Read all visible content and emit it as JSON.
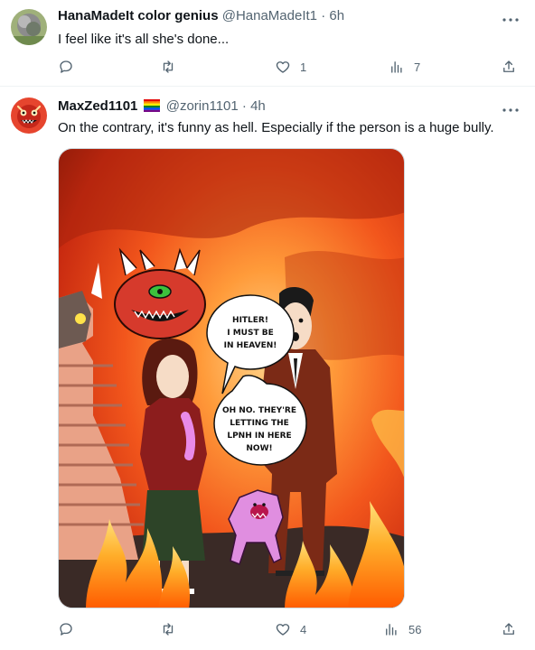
{
  "tweets": [
    {
      "display_name": "HanaMadeIt color genius",
      "handle": "@HanaMadeIt1",
      "time": "6h",
      "text": "I feel like it's all she's done...",
      "actions": {
        "replies": "",
        "reposts": "",
        "likes": "1",
        "views": "7"
      }
    },
    {
      "display_name": "MaxZed1101",
      "handle": "@zorin1101",
      "time": "4h",
      "text": "On the contrary, it's funny as hell. Especially if the person is a huge bully.",
      "actions": {
        "replies": "",
        "reposts": "",
        "likes": "4",
        "views": "56"
      },
      "media": {
        "bubble_top": [
          "HITLER!",
          "I MUST BE",
          "IN HEAVEN!"
        ],
        "bubble_bottom": [
          "OH NO. THEY'RE",
          "LETTING THE",
          "LPNH IN HERE",
          "NOW!"
        ]
      }
    }
  ],
  "separator": "·",
  "icons": [
    "reply-icon",
    "repost-icon",
    "like-icon",
    "views-icon",
    "share-icon",
    "more-icon",
    "rainbow-flag-icon"
  ],
  "colors": {
    "text": "#0f1419",
    "secondary": "#536471",
    "border": "#eff3f4"
  }
}
